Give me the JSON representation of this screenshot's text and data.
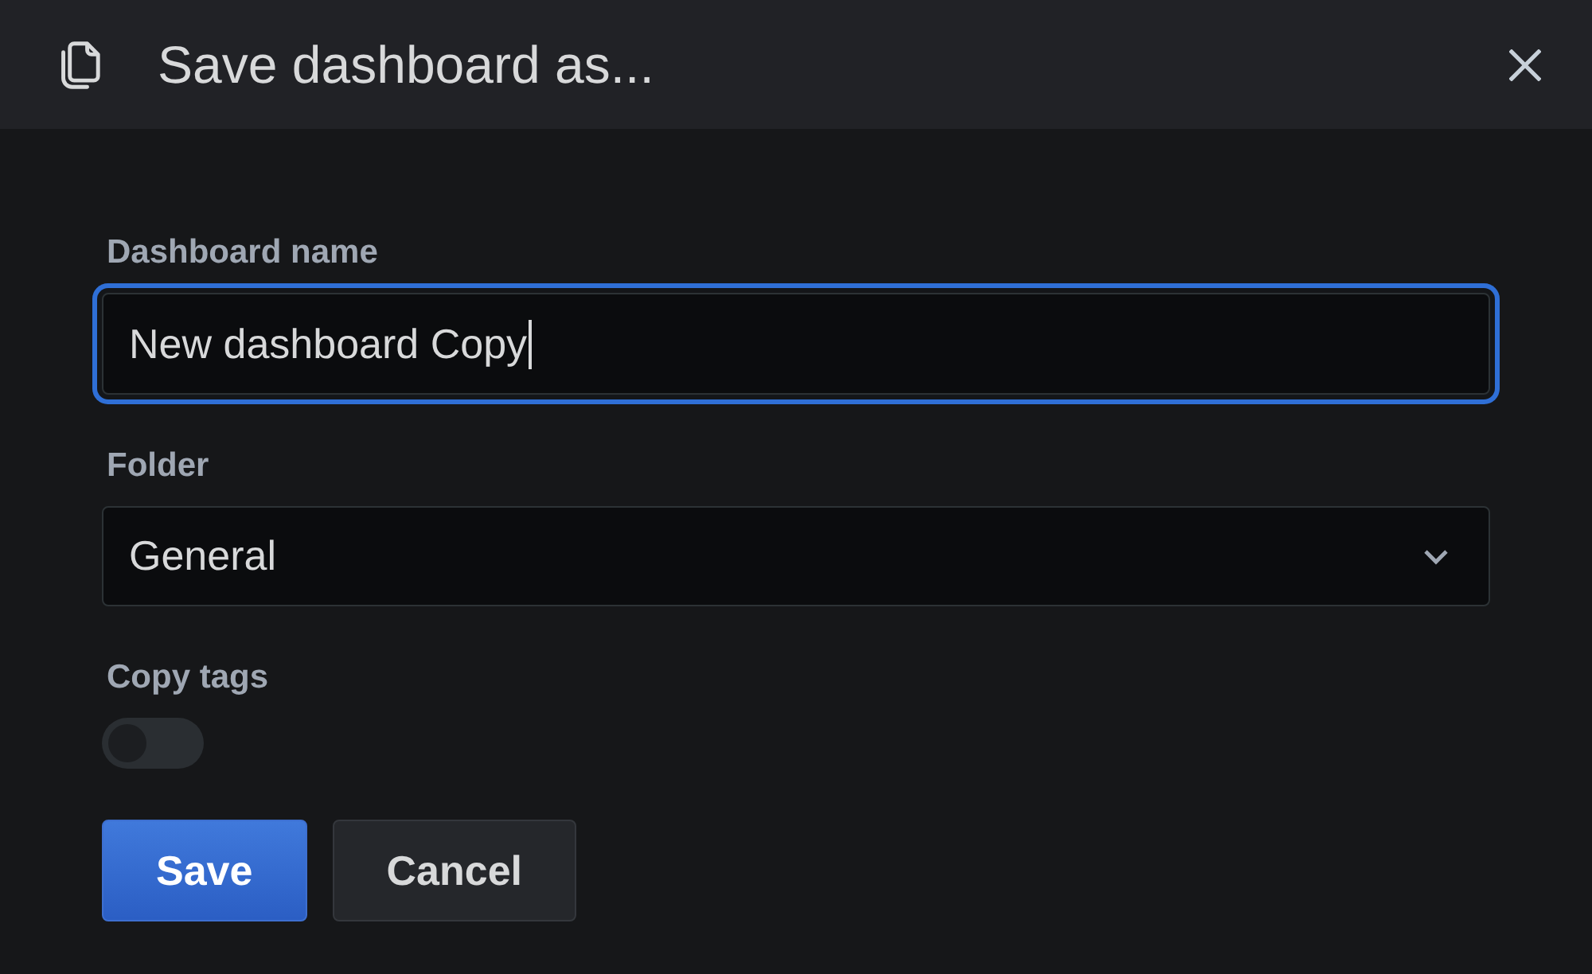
{
  "dialog": {
    "title": "Save dashboard as..."
  },
  "fields": [
    {
      "kind": "text",
      "label": "Dashboard name",
      "value": "New dashboard Copy",
      "focused": true
    },
    {
      "kind": "select",
      "label": "Folder",
      "value": "General"
    },
    {
      "kind": "switch",
      "label": "Copy tags",
      "on": false
    }
  ],
  "buttons": [
    {
      "kind": "primary",
      "label": "Save"
    },
    {
      "kind": "secondary",
      "label": "Cancel"
    }
  ]
}
